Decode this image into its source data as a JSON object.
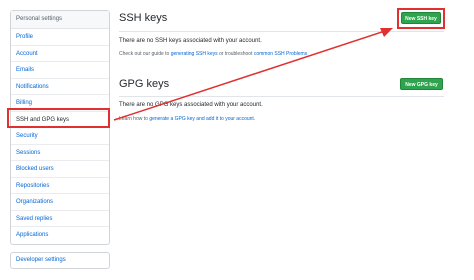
{
  "sidebar": {
    "header": "Personal settings",
    "items": [
      {
        "label": "Profile"
      },
      {
        "label": "Account"
      },
      {
        "label": "Emails"
      },
      {
        "label": "Notifications"
      },
      {
        "label": "Billing"
      },
      {
        "label": "SSH and GPG keys",
        "selected": true
      },
      {
        "label": "Security"
      },
      {
        "label": "Sessions"
      },
      {
        "label": "Blocked users"
      },
      {
        "label": "Repositories"
      },
      {
        "label": "Organizations"
      },
      {
        "label": "Saved replies"
      },
      {
        "label": "Applications"
      }
    ],
    "developer_settings": "Developer settings"
  },
  "ssh": {
    "title": "SSH keys",
    "button": "New SSH key",
    "empty_text": "There are no SSH keys associated with your account.",
    "guide_prefix": "Check out our guide to ",
    "guide_link1": "generating SSH keys",
    "guide_middle": " or troubleshoot ",
    "guide_link2": "common SSH Problems"
  },
  "gpg": {
    "title": "GPG keys",
    "button": "New GPG key",
    "empty_text": "There are no GPG keys associated with your account.",
    "learn_prefix": "Learn how to ",
    "learn_link": "generate a GPG key and add it to your account",
    "learn_suffix": "."
  },
  "colors": {
    "annotation_red": "#e0302f",
    "button_green": "#2ea44f",
    "link_blue": "#0366d6"
  }
}
